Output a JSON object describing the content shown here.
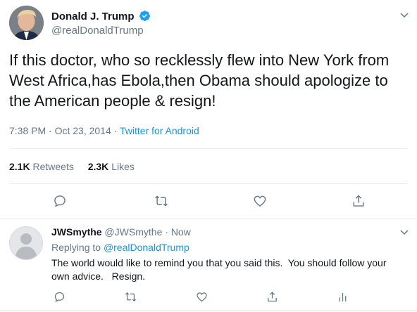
{
  "tweet": {
    "author_name": "Donald J. Trump",
    "author_handle": "@realDonaldTrump",
    "text": "If this doctor, who so recklessly flew into New York from West Africa,has Ebola,then Obama should apologize to the American people & resign!",
    "time": "7:38 PM · Oct 23, 2014",
    "separator": " · ",
    "source": "Twitter for Android",
    "retweets_count": "2.1K",
    "retweets_label": "Retweets",
    "likes_count": "2.3K",
    "likes_label": "Likes",
    "verified_color": "#1da1f2"
  },
  "reply": {
    "author_name": "JWSmythe",
    "author_handle": "@JWSmythe",
    "separator": " · ",
    "time": "Now",
    "replying_label": "Replying to",
    "replying_to": "@realDonaldTrump",
    "text": "The world would like to remind you that you said this.  You should follow your own advice.   Resign."
  },
  "icons": {
    "reply": "reply-icon",
    "retweet": "retweet-icon",
    "like": "like-icon",
    "share": "share-icon",
    "analytics": "analytics-icon",
    "more": "chevron-down-icon"
  },
  "colors": {
    "link": "#1b95e0",
    "secondary_text": "#657786",
    "icon": "#657786"
  }
}
